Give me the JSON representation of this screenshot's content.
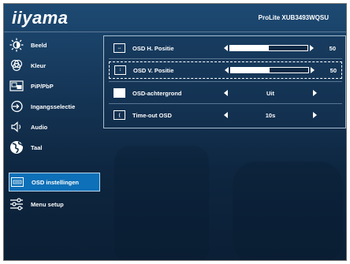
{
  "header": {
    "brand": "iiyama",
    "model": "ProLite XUB3493WQSU"
  },
  "menu": [
    {
      "label": "Beeld",
      "icon": "brightness-icon"
    },
    {
      "label": "Kleur",
      "icon": "color-icon"
    },
    {
      "label": "PiP/PbP",
      "icon": "pip-icon"
    },
    {
      "label": "Ingangsselectie",
      "icon": "input-icon"
    },
    {
      "label": "Audio",
      "icon": "speaker-icon"
    },
    {
      "label": "Taal",
      "icon": "globe-icon"
    },
    {
      "label": "OSD instellingen",
      "icon": "osd-icon",
      "selected": true
    },
    {
      "label": "Menu setup",
      "icon": "sliders-icon"
    }
  ],
  "settings": [
    {
      "label": "OSD H. Positie",
      "type": "slider",
      "value": "50",
      "level": 0.5
    },
    {
      "label": "OSD V. Positie",
      "type": "slider",
      "value": "50",
      "level": 0.5,
      "selected": true
    },
    {
      "label": "OSD-achtergrond",
      "type": "option",
      "value": "Uit"
    },
    {
      "label": "Time-out OSD",
      "type": "option",
      "value": "10s"
    }
  ],
  "colors": {
    "accent": "#0d70b8",
    "panel_border": "#a9bccc",
    "text": "#ffffff"
  }
}
